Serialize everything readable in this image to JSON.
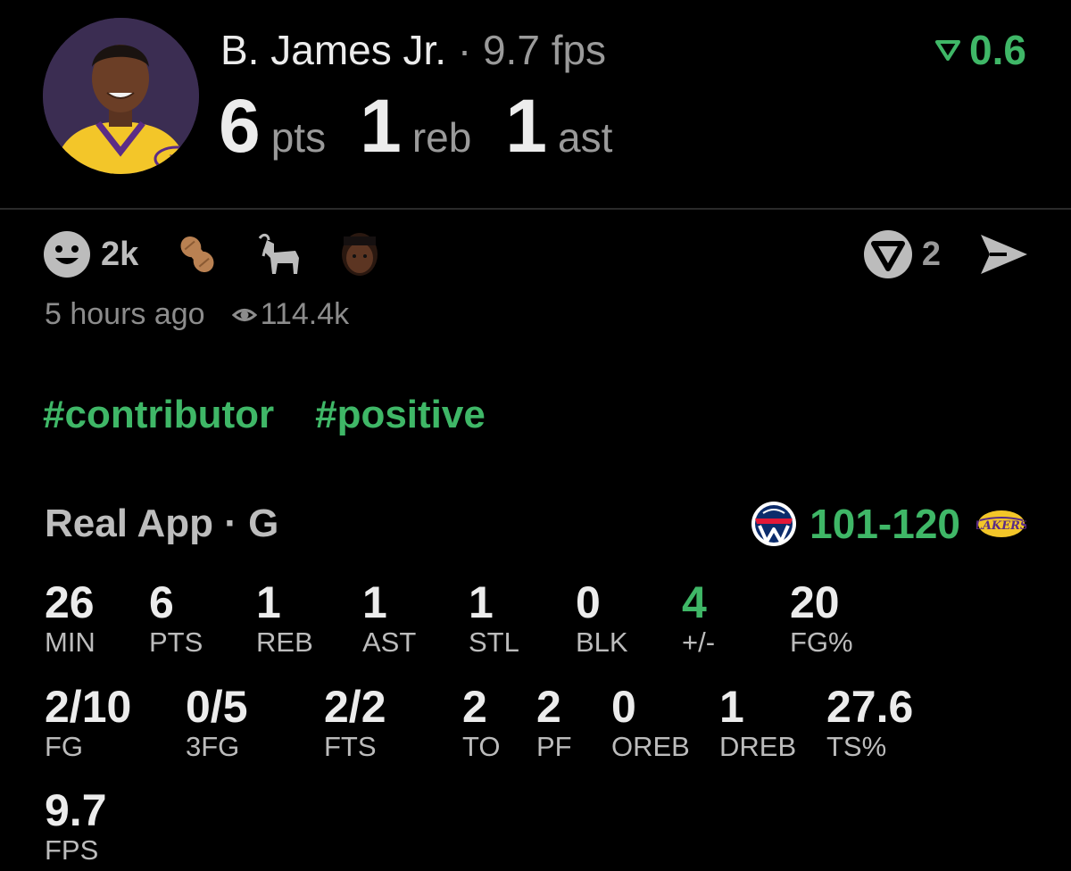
{
  "header": {
    "player_name": "B. James Jr.",
    "separator": "·",
    "fps_text": "9.7 fps",
    "line": [
      {
        "value": "6",
        "unit": "pts"
      },
      {
        "value": "1",
        "unit": "reb"
      },
      {
        "value": "1",
        "unit": "ast"
      }
    ],
    "rating": "0.6",
    "accent": "#3fb767"
  },
  "reactions": {
    "smiley_count": "2k",
    "emojis": [
      "peanut-icon",
      "goat-icon",
      "player-face-icon"
    ],
    "reply_count": "2"
  },
  "meta": {
    "time": "5 hours ago",
    "views": "114.4k"
  },
  "tags": [
    "#contributor",
    "#positive"
  ],
  "game": {
    "title": "Real App · G",
    "score": "101-120"
  },
  "stats": {
    "row1": [
      {
        "value": "26",
        "label": "MIN"
      },
      {
        "value": "6",
        "label": "PTS"
      },
      {
        "value": "1",
        "label": "REB"
      },
      {
        "value": "1",
        "label": "AST"
      },
      {
        "value": "1",
        "label": "STL"
      },
      {
        "value": "0",
        "label": "BLK"
      },
      {
        "value": "4",
        "label": "+/-"
      },
      {
        "value": "20",
        "label": "FG%"
      }
    ],
    "row2": [
      {
        "value": "2/10",
        "label": "FG"
      },
      {
        "value": "0/5",
        "label": "3FG"
      },
      {
        "value": "2/2",
        "label": "FTS"
      },
      {
        "value": "2",
        "label": "TO"
      },
      {
        "value": "2",
        "label": "PF"
      },
      {
        "value": "0",
        "label": "OREB"
      },
      {
        "value": "1",
        "label": "DREB"
      },
      {
        "value": "27.6",
        "label": "TS%"
      }
    ],
    "row3": [
      {
        "value": "9.7",
        "label": "FPS"
      }
    ]
  }
}
